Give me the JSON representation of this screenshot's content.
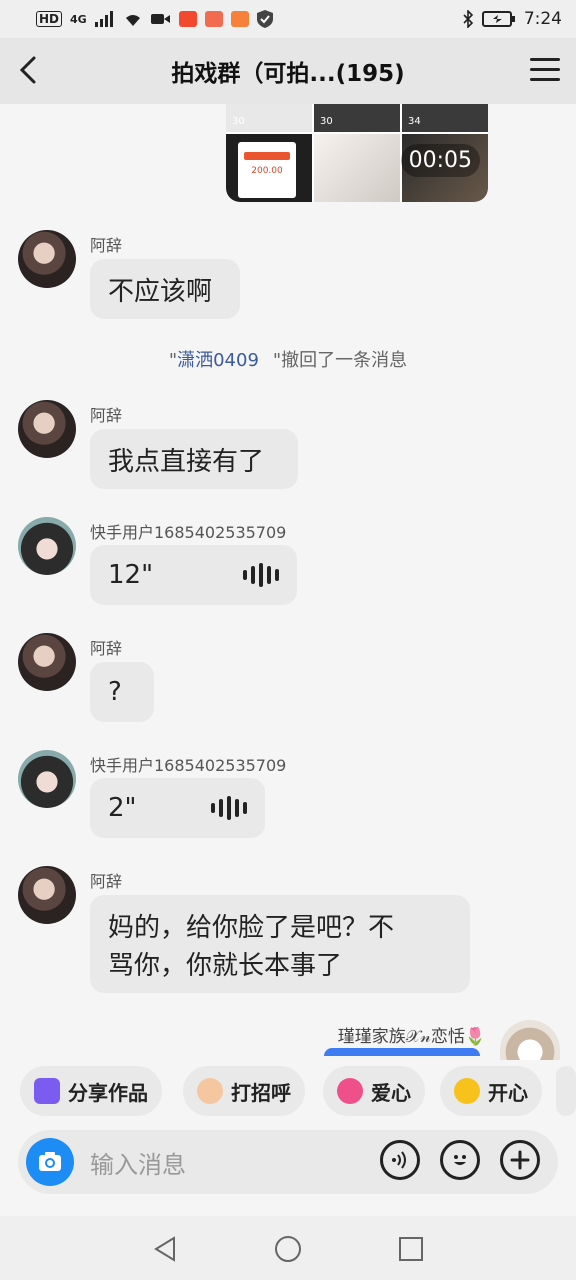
{
  "status_bar": {
    "left_labels": [
      "HD",
      "4G"
    ],
    "time": "7:24",
    "icons": [
      "signal-icon",
      "wifi-icon",
      "video-icon",
      "app-icon-1",
      "app-icon-2",
      "app-icon-3",
      "shield-icon",
      "bluetooth-icon",
      "battery-icon"
    ]
  },
  "header": {
    "title": "拍戏群（可拍...(195)"
  },
  "media_grid": {
    "likes": [
      "30",
      "30",
      "34"
    ],
    "receipt_amount": "200.00",
    "video_duration": "00:05"
  },
  "messages": [
    {
      "sender": "阿辞",
      "text": "不应该啊"
    },
    {
      "sender": "阿辞",
      "text": "我点直接有了"
    },
    {
      "sender": "快手用户1685402535709",
      "voice_duration": "12\""
    },
    {
      "sender": "阿辞",
      "text": "?"
    },
    {
      "sender": "快手用户1685402535709",
      "voice_duration": "2\""
    },
    {
      "sender": "阿辞",
      "text_line1": "妈的，给你脸了是吧？不",
      "text_line2": "骂你，你就长本事了"
    }
  ],
  "recall_notice": {
    "prefix": "\"",
    "user": "潇洒0409",
    "suffix": "\"撤回了一条消息"
  },
  "outgoing": {
    "sender": "瑾瑾家族𝒳𝓃恋恬🌷"
  },
  "quick_replies": [
    {
      "label": "分享作品",
      "icon": "share-works-icon",
      "color": "#7a5cf0"
    },
    {
      "label": "打招呼",
      "icon": "wave-hand-icon",
      "color": "#f4c7a0"
    },
    {
      "label": "爱心",
      "icon": "heart-icon",
      "color": "#f0508a"
    },
    {
      "label": "开心",
      "icon": "laugh-emoji-icon",
      "color": "#f7c21c"
    }
  ],
  "input": {
    "placeholder": "输入消息"
  },
  "colors": {
    "accent_blue": "#1d8cf4",
    "bubble_gray": "#e9e9e9",
    "recall_user": "#3b5b9a"
  }
}
